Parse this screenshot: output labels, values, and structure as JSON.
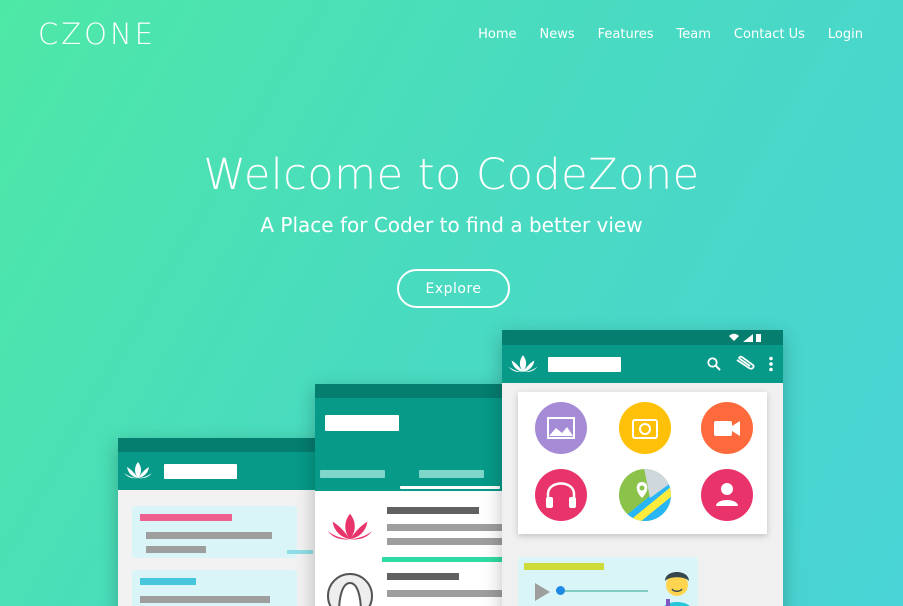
{
  "brand": {
    "logo": "CZONE"
  },
  "nav": {
    "items": [
      "Home",
      "News",
      "Features",
      "Team",
      "Contact Us",
      "Login"
    ]
  },
  "hero": {
    "title": "Welcome to CodeZone",
    "subtitle": "A Place for Coder to find a better view",
    "cta": "Explore"
  },
  "colors": {
    "teal_dark": "#057d6f",
    "teal": "#079a88",
    "purple": "#a58bd6",
    "yellow": "#ffc107",
    "orange": "#ff6a3d",
    "pink": "#e8336b"
  },
  "attach_icons": [
    "image-icon",
    "camera-icon",
    "video-icon",
    "headphones-icon",
    "location-icon",
    "contact-icon"
  ]
}
